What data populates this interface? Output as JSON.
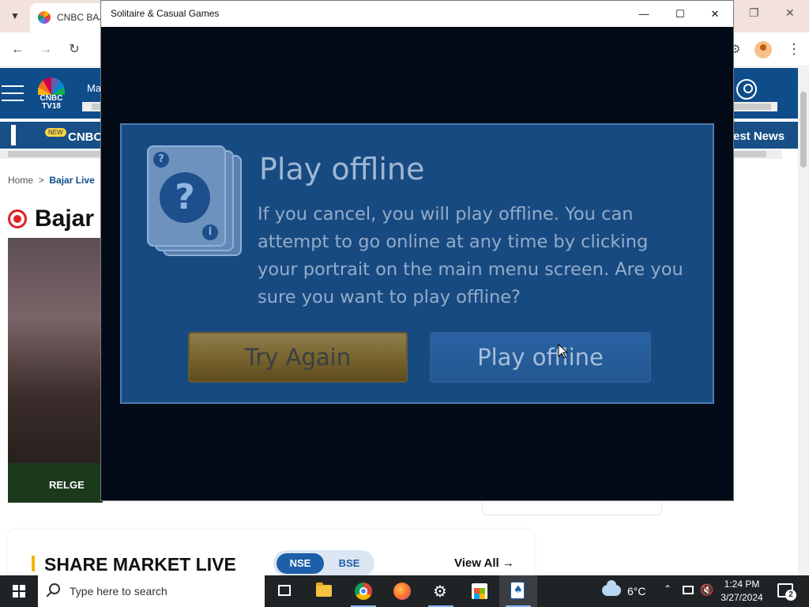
{
  "browser": {
    "tab_title": "CNBC BAJA",
    "site": {
      "header_text": "Ma",
      "logo_text": "CNBC TV18",
      "ticker_new": "NEW",
      "ticker_left": "CNBC",
      "ticker_right": "est News",
      "breadcrumb_home": "Home",
      "breadcrumb_sep": ">",
      "breadcrumb_current": "Bajar Live",
      "page_heading": "Bajar",
      "video_caption": "RELGE",
      "market_title": "SHARE MARKET LIVE",
      "toggle_nse": "NSE",
      "toggle_bse": "BSE",
      "view_all": "View All →"
    }
  },
  "game": {
    "window_title": "Solitaire & Casual Games",
    "controls": {
      "minimize": "—",
      "maximize": "☐",
      "close": "✕"
    },
    "dialog": {
      "title": "Play offline",
      "body": "If you cancel, you will play offline. You can attempt to go online at any time by clicking your portrait on the main menu screen. Are you sure you want to play offline?",
      "try_again": "Try Again",
      "play_offline": "Play offline",
      "card_glyph_big": "?",
      "card_glyph_small": "?",
      "card_glyph_corner": "i"
    }
  },
  "taskbar": {
    "search_placeholder": "Type here to search",
    "temperature": "6°C",
    "time": "1:24 PM",
    "date": "3/27/2024",
    "notification_count": "2"
  },
  "colors": {
    "dialog_bg": "#184a82",
    "try_again_btn": "#7b6830",
    "play_offline_btn": "#22578f",
    "site_header": "#0f4c8a"
  }
}
